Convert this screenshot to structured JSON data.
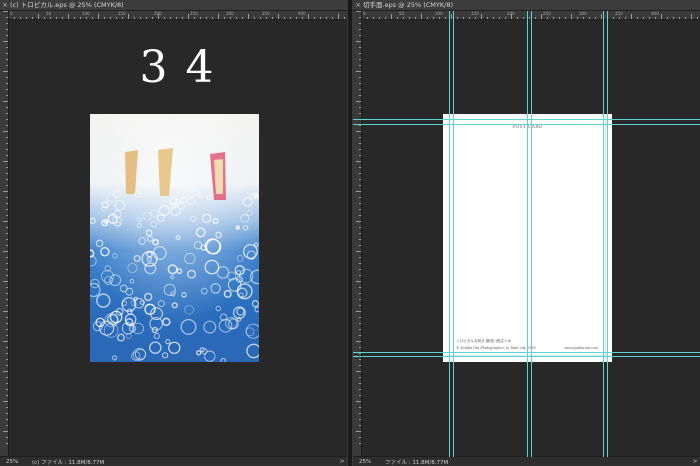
{
  "left_document": {
    "tab": {
      "close_glyph": "×",
      "title": "(c) トロピカル.eps @ 25% (CMYK/8)"
    },
    "page_number": "3 4",
    "status": {
      "zoom": "25%",
      "info": "(c) ファイル : 11.8M/8.77M",
      "arrow": ">"
    }
  },
  "right_document": {
    "tab": {
      "close_glyph": "×",
      "title": "切手面.eps @ 25% (CMYK/8)"
    },
    "postcard": {
      "title": "POST CARD",
      "credit_line1": "トロピカルな気分   藤田川西注ぐ水",
      "credit_line2": "© Yutaka Ota Photographer, in Taidi city 2016",
      "url": "www.yutaka-ota.com"
    },
    "status": {
      "zoom": "25%",
      "info": "ファイル : 11.8M/8.77M",
      "arrow": ">"
    }
  },
  "ruler_labels": [
    "0",
    "50",
    "100",
    "150",
    "200",
    "250",
    "300",
    "350",
    "400"
  ],
  "icons": {
    "close": "close-icon",
    "arrow": "chevron-right-icon"
  },
  "colors": {
    "guide": "#5fd3d3",
    "canvas": "#282828",
    "tab": "#3c3c3c"
  }
}
